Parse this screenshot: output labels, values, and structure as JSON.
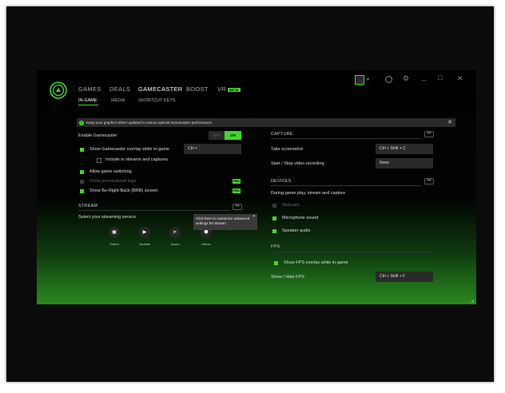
{
  "nav": {
    "tabs": [
      "GAMES",
      "DEALS",
      "GAMECASTER",
      "BOOST",
      "VR"
    ],
    "vr_badge": "BETA",
    "subtabs": [
      "IN-GAME",
      "MEDIA",
      "SHORTCUT KEYS"
    ]
  },
  "window": {
    "minimize": "_",
    "maximize": "□",
    "close": "✕",
    "profile_caret": "▾"
  },
  "banner": {
    "text": "Keep your graphics driver updated to ensure optimal Gamecaster performance.",
    "close": "✕"
  },
  "left": {
    "enable_label": "Enable Gamecaster",
    "toggle_off": "OFF",
    "toggle_on": "ON",
    "show_overlay": "Show Gamecaster overlay while in-game",
    "overlay_shortcut": "Ctrl + `",
    "include_streams": "Include in streams and captures",
    "allow_switching": "Allow game switching",
    "show_personalized": "Show personalized logo",
    "show_brb": "Show Be-Right-Back (BRB) screen",
    "pro_label": "PRO"
  },
  "stream": {
    "title": "STREAM",
    "more": "•••",
    "select_label": "Select your streaming service",
    "services": [
      "Twitch",
      "Youtube",
      "Azubu",
      "Hitbox"
    ],
    "tooltip": "Click here to customize advanced settings for Stream.",
    "tooltip_close": "✕"
  },
  "capture": {
    "title": "CAPTURE",
    "more": "•••",
    "screenshot_label": "Take screenshot",
    "screenshot_key": "Ctrl + Shift + C",
    "record_label": "Start / Stop video recording",
    "record_key": "None"
  },
  "devices": {
    "title": "DEVICES",
    "more": "•••",
    "during_label": "During game play, stream and capture",
    "webcam": "Webcam",
    "microphone": "Microphone sound",
    "speaker": "Speaker audio"
  },
  "fps": {
    "title": "FPS",
    "show_overlay": "Show FPS overlay while in-game",
    "hide_label": "Show / Hide FPS",
    "hide_key": "Ctrl + Shift + F"
  },
  "colors": {
    "accent": "#44d62c",
    "background": "#000000"
  }
}
